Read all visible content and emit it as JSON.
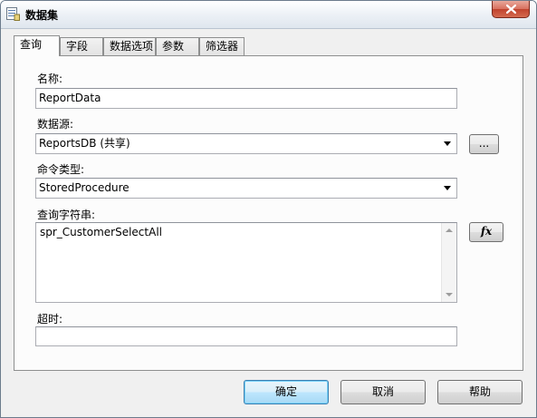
{
  "window": {
    "title": "数据集",
    "icon": "dataset-icon",
    "close_icon": "close-icon"
  },
  "tabs": [
    {
      "label": "查询",
      "active": true
    },
    {
      "label": "字段",
      "active": false
    },
    {
      "label": "数据选项",
      "active": false
    },
    {
      "label": "参数",
      "active": false
    },
    {
      "label": "筛选器",
      "active": false
    }
  ],
  "form": {
    "name_label": "名称:",
    "name_value": "ReportData",
    "datasource_label": "数据源:",
    "datasource_value": "ReportsDB (共享)",
    "browse_label": "...",
    "command_type_label": "命令类型:",
    "command_type_value": "StoredProcedure",
    "query_label": "查询字符串:",
    "query_value": "spr_CustomerSelectAll",
    "expression_label": "fx",
    "timeout_label": "超时:",
    "timeout_value": ""
  },
  "buttons": {
    "ok": "确定",
    "cancel": "取消",
    "help": "帮助"
  },
  "colors": {
    "default_button_border": "#3c7fb1",
    "close_button": "#c0432e"
  }
}
